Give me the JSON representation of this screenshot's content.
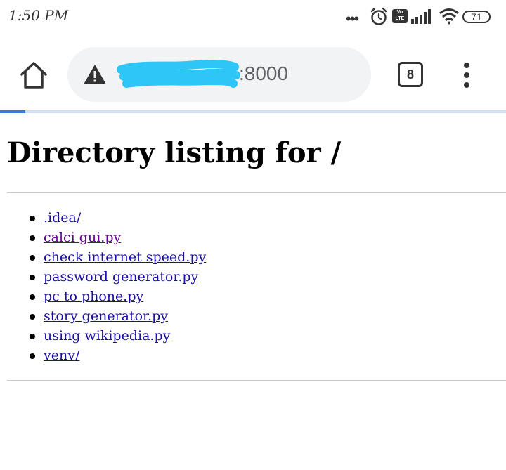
{
  "status_bar": {
    "time": "1:50 PM",
    "icons": [
      "more-dots-icon",
      "alarm-icon",
      "volte-icon",
      "signal-icon",
      "wifi-icon",
      "battery-icon"
    ],
    "volte_label": "Vo LTE",
    "battery": "71"
  },
  "toolbar": {
    "url_suffix": ":8000",
    "tab_count": "8",
    "load_progress": 0.05,
    "colors": {
      "accent": "#3b78e7",
      "scribble": "#2ec5f7"
    }
  },
  "page": {
    "title": "Directory listing for /",
    "files": [
      {
        "name": ".idea/",
        "visited": false
      },
      {
        "name": "calci gui.py",
        "visited": true
      },
      {
        "name": "check internet speed.py",
        "visited": false
      },
      {
        "name": "password generator.py",
        "visited": false
      },
      {
        "name": "pc to phone.py",
        "visited": false
      },
      {
        "name": "story generator.py",
        "visited": false
      },
      {
        "name": "using wikipedia.py",
        "visited": false
      },
      {
        "name": "venv/",
        "visited": false
      }
    ]
  }
}
